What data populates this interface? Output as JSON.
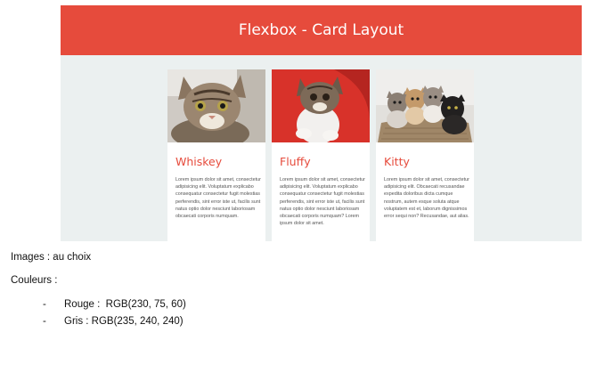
{
  "demo": {
    "title": "Flexbox - Card Layout",
    "cards": [
      {
        "title": "Whiskey",
        "image": "tabby-kitten-photo",
        "text": "Lorem ipsum dolor sit amet, consectetur adipisicing elit. Voluptatum explicabo consequatur consectetur fugit molestias perferendis, sint error iste ut, facilis sunt natus optio dolor nesciunt laboriosam obcaecati corporis numquam."
      },
      {
        "title": "Fluffy",
        "image": "fluffy-kitten-photo",
        "text": "Lorem ipsum dolor sit amet, consectetur adipisicing elit. Voluptatum explicabo consequatur consectetur fugit molestias perferendis, sint error iste ut, facilis sunt natus optio dolor nesciunt laboriosam obcaecati corporis numquam? Lorem ipsum dolor sit amet."
      },
      {
        "title": "Kitty",
        "image": "kittens-group-photo",
        "text": "Lorem ipsum dolor sit amet, consectetur adipisicing elit. Obcaecati recusandae expedita doloribus dicta cumque nostrum, autem esque soluta atque voluptatem est et, laborum dignissimos error sequi non? Recusandae, aut alias."
      }
    ]
  },
  "notes": {
    "images_line": "Images : au choix",
    "colors_heading": "Couleurs :",
    "bullet_marker": "-",
    "colors": [
      "Rouge :  RGB(230, 75, 60)",
      "Gris : RGB(235, 240, 240)"
    ]
  },
  "colors": {
    "red": "#e64b3c",
    "gray": "#ebf0f0"
  }
}
